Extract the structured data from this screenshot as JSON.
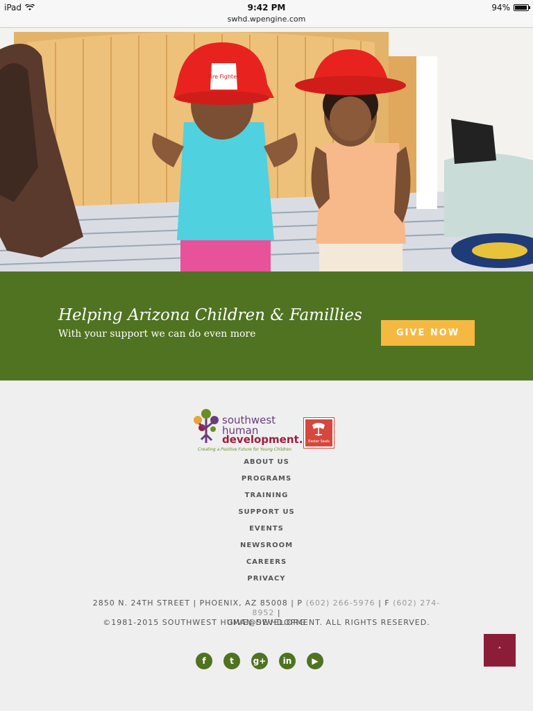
{
  "status_bar": {
    "device": "iPad",
    "time": "9:42 PM",
    "url": "swhd.wpengine.com",
    "battery": "94%",
    "battery_level": 0.94
  },
  "hero": {
    "hat_text": "Fire Fighter"
  },
  "banner": {
    "title": "Helping Arizona Children & Famillies",
    "subtitle": "With your support we can do even more",
    "button_label": "GIVE NOW",
    "bg_color": "#4f7321",
    "button_color": "#f5b942"
  },
  "logo": {
    "line1": "southwest",
    "line2": "human",
    "line3": "development.",
    "tagline": "Creating a Positive Future for Young Children",
    "partner_text": "Easter Seals"
  },
  "footer_nav": [
    "ABOUT US",
    "PROGRAMS",
    "TRAINING",
    "SUPPORT US",
    "EVENTS",
    "NEWSROOM",
    "CAREERS",
    "PRIVACY"
  ],
  "address": {
    "line_prefix": "2850 N. 24TH STREET | PHOENIX, AZ 85008 | P",
    "phone": "(602) 266-5976",
    "fax_prefix": "| F",
    "fax": "(602) 274-8952",
    "line_suffix": "|",
    "email": "GIVE@SWHD.ORG"
  },
  "copyright": "©1981-2015 SOUTHWEST HUMAN DEVELOPMENT. ALL RIGHTS RESERVED.",
  "social": {
    "facebook": "f",
    "twitter": "t",
    "googleplus": "g+",
    "linkedin": "in",
    "youtube": "▶"
  },
  "back_to_top": "˄"
}
